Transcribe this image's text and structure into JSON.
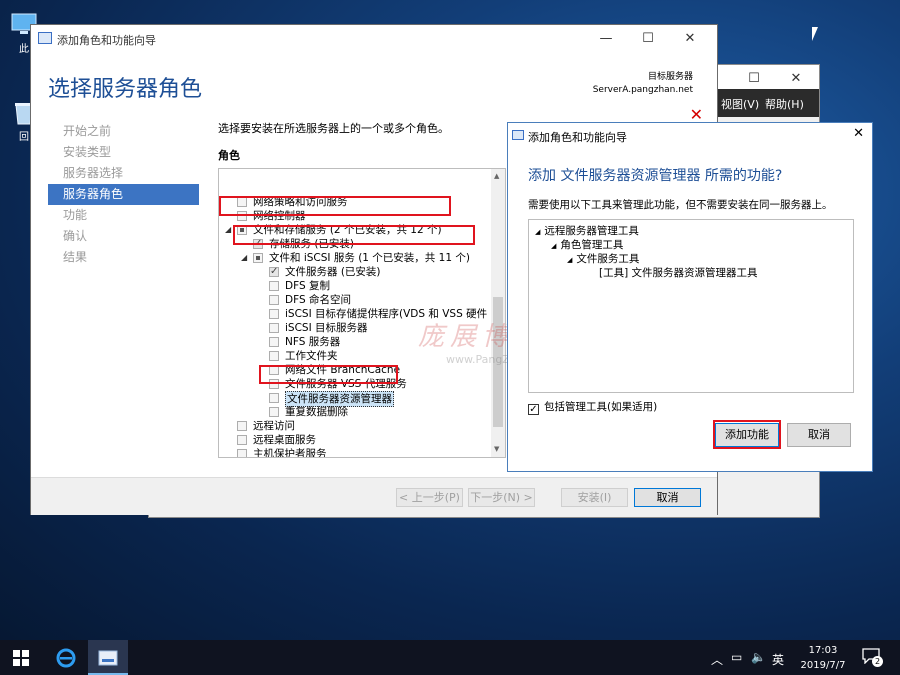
{
  "desktop": {
    "icons": [
      {
        "label": "此"
      },
      {
        "label": "回"
      }
    ]
  },
  "bg_window": {
    "menu": {
      "view": "视图(V)",
      "help": "帮助(H)"
    }
  },
  "wizard": {
    "window_title": "添加角色和功能向导",
    "page_title": "选择服务器角色",
    "target_label": "目标服务器",
    "target_server": "ServerA.pangzhan.net",
    "nav": [
      "开始之前",
      "安装类型",
      "服务器选择",
      "服务器角色",
      "功能",
      "确认",
      "结果"
    ],
    "active_nav_index": 3,
    "description": "选择要安装在所选服务器上的一个或多个角色。",
    "roles_label": "角色",
    "roles": [
      {
        "label": "网络策略和访问服务",
        "indent": 0,
        "state": "unchecked"
      },
      {
        "label": "网络控制器",
        "indent": 0,
        "state": "unchecked"
      },
      {
        "label": "文件和存储服务 (2 个已安装，共 12 个)",
        "indent": 0,
        "state": "partial",
        "expanded": true
      },
      {
        "label": "存储服务 (已安装)",
        "indent": 1,
        "state": "checked"
      },
      {
        "label": "文件和 iSCSI 服务 (1 个已安装，共 11 个)",
        "indent": 1,
        "state": "partial",
        "expanded": true
      },
      {
        "label": "文件服务器 (已安装)",
        "indent": 2,
        "state": "checked"
      },
      {
        "label": "DFS 复制",
        "indent": 2,
        "state": "unchecked"
      },
      {
        "label": "DFS 命名空间",
        "indent": 2,
        "state": "unchecked"
      },
      {
        "label": "iSCSI 目标存储提供程序(VDS 和 VSS 硬件",
        "indent": 2,
        "state": "unchecked"
      },
      {
        "label": "iSCSI 目标服务器",
        "indent": 2,
        "state": "unchecked"
      },
      {
        "label": "NFS 服务器",
        "indent": 2,
        "state": "unchecked"
      },
      {
        "label": "工作文件夹",
        "indent": 2,
        "state": "unchecked"
      },
      {
        "label": "网络文件 BranchCache",
        "indent": 2,
        "state": "unchecked"
      },
      {
        "label": "文件服务器 VSS 代理服务",
        "indent": 2,
        "state": "unchecked"
      },
      {
        "label": "文件服务器资源管理器",
        "indent": 2,
        "state": "unchecked",
        "selected": true
      },
      {
        "label": "重复数据删除",
        "indent": 2,
        "state": "unchecked"
      },
      {
        "label": "远程访问",
        "indent": 0,
        "state": "unchecked"
      },
      {
        "label": "远程桌面服务",
        "indent": 0,
        "state": "unchecked"
      },
      {
        "label": "主机保护者服务",
        "indent": 0,
        "state": "unchecked"
      }
    ],
    "buttons": {
      "prev": "< 上一步(P)",
      "next": "下一步(N) >",
      "install": "安装(I)",
      "cancel": "取消"
    }
  },
  "dialog": {
    "title": "添加角色和功能向导",
    "heading": "添加 文件服务器资源管理器 所需的功能?",
    "description": "需要使用以下工具来管理此功能，但不需要安装在同一服务器上。",
    "features": [
      {
        "label": "远程服务器管理工具",
        "indent": 0,
        "expander": true
      },
      {
        "label": "角色管理工具",
        "indent": 1,
        "expander": true
      },
      {
        "label": "文件服务工具",
        "indent": 2,
        "expander": true
      },
      {
        "label": "[工具] 文件服务器资源管理器工具",
        "indent": 3,
        "expander": false
      }
    ],
    "include_tools": "包括管理工具(如果适用)",
    "include_tools_checked": true,
    "add_button": "添加功能",
    "cancel_button": "取消"
  },
  "watermark": {
    "brand": "庞展博客",
    "url": "www.PangZhan.net"
  },
  "taskbar": {
    "ime": "英",
    "time": "17:03",
    "date": "2019/7/7",
    "notification_count": "2"
  }
}
